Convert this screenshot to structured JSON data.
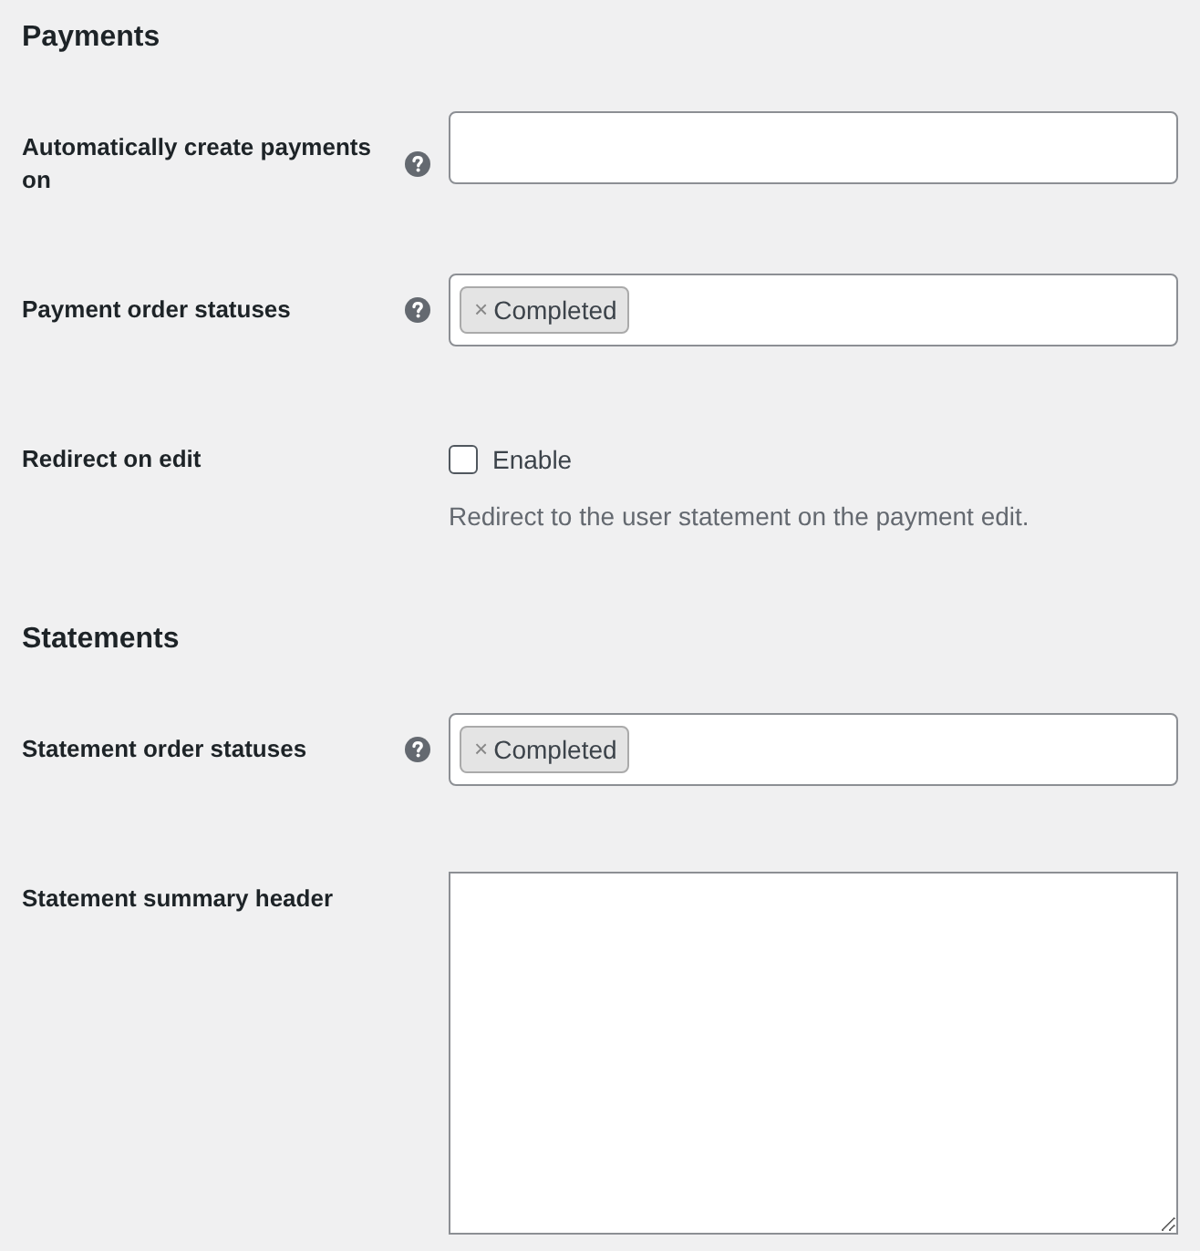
{
  "sections": [
    {
      "title": "Payments",
      "fields": [
        {
          "kind": "text",
          "label": "Automatically create payments on",
          "help_tip": true
        },
        {
          "kind": "tags",
          "label": "Payment order statuses",
          "help_tip": true,
          "tags": [
            {
              "remove": "×",
              "label": "Completed"
            }
          ]
        },
        {
          "kind": "checkbox",
          "label": "Redirect on edit",
          "help_tip": false,
          "option": "Enable",
          "checked": false,
          "description": "Redirect to the user statement on the payment edit."
        }
      ]
    },
    {
      "title": "Statements",
      "fields": [
        {
          "kind": "tags",
          "label": "Statement order statuses",
          "help_tip": true,
          "tags": [
            {
              "remove": "×",
              "label": "Completed"
            }
          ]
        },
        {
          "kind": "textarea",
          "label": "Statement summary header",
          "help_tip": false
        }
      ]
    }
  ]
}
